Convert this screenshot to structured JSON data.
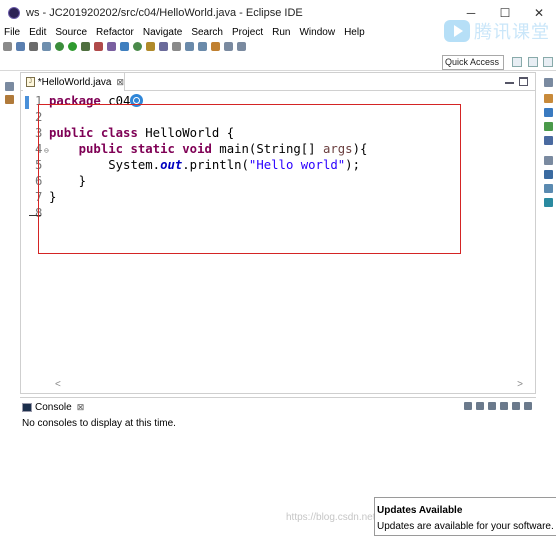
{
  "window": {
    "title": "ws - JC201920202/src/c04/HelloWorld.java - Eclipse IDE",
    "minimize": "─",
    "maximize": "☐",
    "close": "✕"
  },
  "watermark": {
    "logo_text": "腾讯课堂",
    "footer_text": "https://blog.csdn.net/weixin_45..."
  },
  "menu": [
    "File",
    "Edit",
    "Source",
    "Refactor",
    "Navigate",
    "Search",
    "Project",
    "Run",
    "Window",
    "Help"
  ],
  "quick_access": {
    "placeholder": "Quick Access"
  },
  "editor": {
    "tab_label": "*HelloWorld.java",
    "tab_close": "⊠",
    "lines": [
      {
        "no": "1",
        "text": "package c04"
      },
      {
        "no": "2",
        "text": ""
      },
      {
        "no": "3",
        "text": "public class HelloWorld {"
      },
      {
        "no": "4",
        "text": "    public static void main(String[] args){"
      },
      {
        "no": "5",
        "text": "        System.out.println(\"Hello world\");"
      },
      {
        "no": "6",
        "text": "    }"
      },
      {
        "no": "7",
        "text": "}"
      },
      {
        "no": "8",
        "text": ""
      }
    ],
    "tokens": {
      "package": "package",
      "package_name": " c04",
      "public": "public",
      "class": "class",
      "class_name": " HelloWorld {",
      "static": "static",
      "void": "void",
      "main": " main(String[] ",
      "args": "args",
      "main_end": "){",
      "system": "System.",
      "out": "out",
      "println": ".println(",
      "string": "\"Hello world\"",
      "println_end": ");",
      "close_inner": "    }",
      "close_outer": "}"
    },
    "scroll_left": "<",
    "scroll_right": ">"
  },
  "console": {
    "tab_label": "Console",
    "tab_close": "⊠",
    "message": "No consoles to display at this time."
  },
  "notification": {
    "title": "Updates Available",
    "body": "Updates are available for your software."
  },
  "colors": {
    "keyword": "#7f0055",
    "string": "#2a00ff",
    "field": "#0000c0",
    "highlight_box": "#d42424",
    "accent": "#4a90d9"
  }
}
